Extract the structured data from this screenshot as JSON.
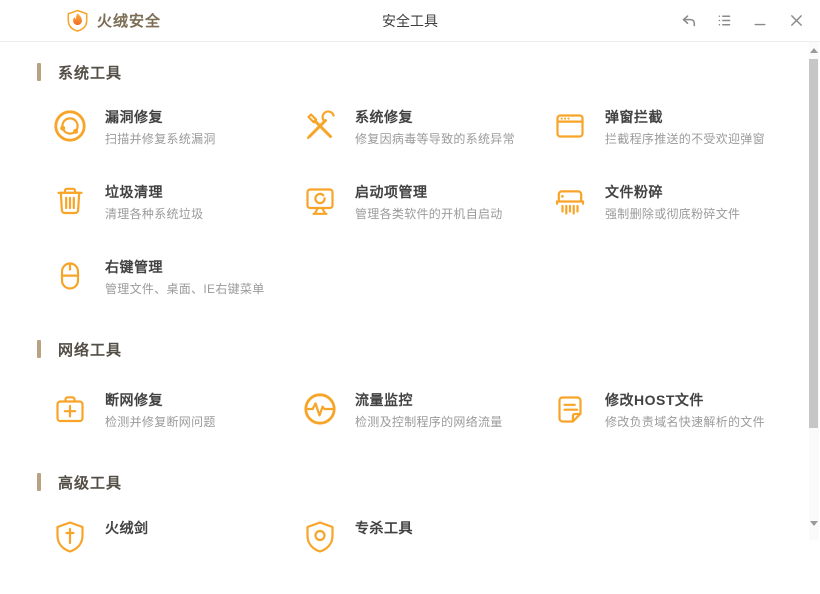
{
  "colors": {
    "accent": "#f7a428",
    "brand_text": "#7b6e54",
    "section_bar": "#b9a284",
    "section_label": "#534e46",
    "tool_title": "#424242",
    "tool_desc": "#9b9b9b",
    "titlebar_icon": "#8a8a8a"
  },
  "titlebar": {
    "app_name": "火绒安全",
    "window_title": "安全工具"
  },
  "sections": [
    {
      "label": "系统工具",
      "tools": [
        {
          "icon": "vulnerability-scan-icon",
          "title": "漏洞修复",
          "desc": "扫描并修复系统漏洞"
        },
        {
          "icon": "system-repair-icon",
          "title": "系统修复",
          "desc": "修复因病毒等导致的系统异常"
        },
        {
          "icon": "popup-block-icon",
          "title": "弹窗拦截",
          "desc": "拦截程序推送的不受欢迎弹窗"
        },
        {
          "icon": "trash-icon",
          "title": "垃圾清理",
          "desc": "清理各种系统垃圾"
        },
        {
          "icon": "startup-monitor-icon",
          "title": "启动项管理",
          "desc": "管理各类软件的开机自启动"
        },
        {
          "icon": "file-shredder-icon",
          "title": "文件粉碎",
          "desc": "强制删除或彻底粉碎文件"
        },
        {
          "icon": "mouse-icon",
          "title": "右键管理",
          "desc": "管理文件、桌面、IE右键菜单"
        }
      ]
    },
    {
      "label": "网络工具",
      "tools": [
        {
          "icon": "network-repair-icon",
          "title": "断网修复",
          "desc": "检测并修复断网问题"
        },
        {
          "icon": "traffic-monitor-icon",
          "title": "流量监控",
          "desc": "检测及控制程序的网络流量"
        },
        {
          "icon": "host-file-icon",
          "title": "修改HOST文件",
          "desc": "修改负责域名快速解析的文件"
        }
      ]
    },
    {
      "label": "高级工具",
      "tools": [
        {
          "icon": "shield-sword-icon",
          "title": "火绒剑",
          "desc": ""
        },
        {
          "icon": "shield-kill-icon",
          "title": "专杀工具",
          "desc": ""
        }
      ]
    }
  ]
}
